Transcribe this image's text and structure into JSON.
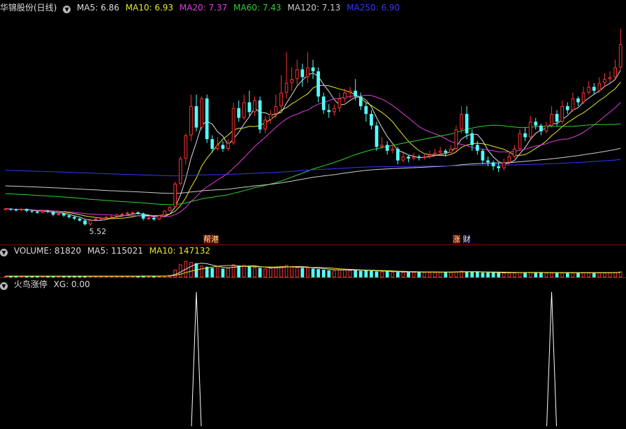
{
  "header": {
    "title": "华锦股份(日线)",
    "ma5": "MA5: 6.86",
    "ma10": "MA10: 6.93",
    "ma20": "MA20: 7.37",
    "ma60": "MA60: 7.43",
    "ma120": "MA120: 7.13",
    "ma250": "MA250: 6.90"
  },
  "volume_header": {
    "volume": "VOLUME: 81820",
    "ma5": "MA5: 115021",
    "ma10": "MA10: 147132"
  },
  "indicator_header": {
    "name": "火鸟涨停",
    "xg": "XG: 0.00"
  },
  "tags": [
    "帮港",
    "涨",
    "财"
  ],
  "price": {
    "low_label": "5.52"
  },
  "colors": {
    "up": "#ff3232",
    "down": "#54ffff",
    "ma5": "#dddddd",
    "ma10": "#e8e82a",
    "ma20": "#e23ce2",
    "ma60": "#30d030",
    "ma120": "#cccccc",
    "ma250": "#3535ff",
    "divider": "#a00000"
  },
  "chart_data": {
    "type": "candlestick",
    "price_range": [
      5.3,
      10.8
    ],
    "candles": [
      [
        5.92,
        5.96,
        5.86,
        5.85
      ],
      [
        5.95,
        5.93,
        5.97,
        5.9
      ],
      [
        5.93,
        5.92,
        5.96,
        5.88
      ],
      [
        5.92,
        5.95,
        5.98,
        5.9
      ],
      [
        5.95,
        5.9,
        5.96,
        5.86
      ],
      [
        5.9,
        5.88,
        5.93,
        5.84
      ],
      [
        5.88,
        5.85,
        5.9,
        5.82
      ],
      [
        5.85,
        5.9,
        5.93,
        5.83
      ],
      [
        5.9,
        5.88,
        5.92,
        5.84
      ],
      [
        5.88,
        5.8,
        5.9,
        5.76
      ],
      [
        5.8,
        5.83,
        5.86,
        5.77
      ],
      [
        5.83,
        5.78,
        5.85,
        5.74
      ],
      [
        5.78,
        5.74,
        5.8,
        5.7
      ],
      [
        5.74,
        5.7,
        5.76,
        5.66
      ],
      [
        5.7,
        5.65,
        5.72,
        5.62
      ],
      [
        5.65,
        5.55,
        5.68,
        5.52
      ],
      [
        5.55,
        5.66,
        5.7,
        5.52
      ],
      [
        5.66,
        5.7,
        5.73,
        5.62
      ],
      [
        5.7,
        5.72,
        5.75,
        5.66
      ],
      [
        5.72,
        5.74,
        5.77,
        5.68
      ],
      [
        5.74,
        5.75,
        5.78,
        5.7
      ],
      [
        5.75,
        5.8,
        5.83,
        5.72
      ],
      [
        5.8,
        5.82,
        5.85,
        5.76
      ],
      [
        5.82,
        5.85,
        5.88,
        5.78
      ],
      [
        5.85,
        5.86,
        5.9,
        5.8
      ],
      [
        5.86,
        5.83,
        5.88,
        5.8
      ],
      [
        5.83,
        5.7,
        5.86,
        5.65
      ],
      [
        5.7,
        5.72,
        5.75,
        5.66
      ],
      [
        5.72,
        5.68,
        5.74,
        5.64
      ],
      [
        5.68,
        5.78,
        5.8,
        5.66
      ],
      [
        5.78,
        5.9,
        5.92,
        5.76
      ],
      [
        5.9,
        6.0,
        6.03,
        5.88
      ],
      [
        6.0,
        6.6,
        6.65,
        5.98
      ],
      [
        6.6,
        7.25,
        7.3,
        6.55
      ],
      [
        7.25,
        7.85,
        7.9,
        7.1
      ],
      [
        7.85,
        8.6,
        8.9,
        7.7
      ],
      [
        8.6,
        8.05,
        8.9,
        7.95
      ],
      [
        8.05,
        8.8,
        8.85,
        7.98
      ],
      [
        8.8,
        7.75,
        8.9,
        7.65
      ],
      [
        7.75,
        7.5,
        7.85,
        7.4
      ],
      [
        7.5,
        7.6,
        7.8,
        7.45
      ],
      [
        7.6,
        7.5,
        7.7,
        7.42
      ],
      [
        7.5,
        7.65,
        7.75,
        7.45
      ],
      [
        7.65,
        8.55,
        8.7,
        7.6
      ],
      [
        8.55,
        8.3,
        8.75,
        8.2
      ],
      [
        8.3,
        8.7,
        8.9,
        8.25
      ],
      [
        8.7,
        8.45,
        9.0,
        8.35
      ],
      [
        8.45,
        8.75,
        8.85,
        8.35
      ],
      [
        8.75,
        8.0,
        8.85,
        7.9
      ],
      [
        8.0,
        8.25,
        8.35,
        7.9
      ],
      [
        8.25,
        8.4,
        8.5,
        8.15
      ],
      [
        8.4,
        8.6,
        8.9,
        8.3
      ],
      [
        8.6,
        8.95,
        9.4,
        8.5
      ],
      [
        8.95,
        9.2,
        10.0,
        8.8
      ],
      [
        9.2,
        9.3,
        9.6,
        9.0
      ],
      [
        9.3,
        9.55,
        9.8,
        9.15
      ],
      [
        9.55,
        9.35,
        9.7,
        9.1
      ],
      [
        9.35,
        9.6,
        10.0,
        9.2
      ],
      [
        9.6,
        9.5,
        9.8,
        9.3
      ],
      [
        9.5,
        8.85,
        9.6,
        8.7
      ],
      [
        8.85,
        8.5,
        8.95,
        8.4
      ],
      [
        8.5,
        8.45,
        8.65,
        8.3
      ],
      [
        8.45,
        8.55,
        8.65,
        8.35
      ],
      [
        8.55,
        8.8,
        8.95,
        8.45
      ],
      [
        8.8,
        8.95,
        9.05,
        8.7
      ],
      [
        8.95,
        9.0,
        9.1,
        8.8
      ],
      [
        9.0,
        8.85,
        9.3,
        8.75
      ],
      [
        8.85,
        8.6,
        8.95,
        8.5
      ],
      [
        8.6,
        8.4,
        8.7,
        8.2
      ],
      [
        8.4,
        8.1,
        8.5,
        8.0
      ],
      [
        8.1,
        7.55,
        8.2,
        7.45
      ],
      [
        7.55,
        7.6,
        7.8,
        7.5
      ],
      [
        7.6,
        7.45,
        7.7,
        7.35
      ],
      [
        7.45,
        7.5,
        7.6,
        7.38
      ],
      [
        7.5,
        7.2,
        7.55,
        7.1
      ],
      [
        7.2,
        7.3,
        7.4,
        7.15
      ],
      [
        7.3,
        7.25,
        7.35,
        7.15
      ],
      [
        7.25,
        7.3,
        7.4,
        7.2
      ],
      [
        7.3,
        7.28,
        7.35,
        7.2
      ],
      [
        7.28,
        7.3,
        7.38,
        7.22
      ],
      [
        7.3,
        7.35,
        7.45,
        7.25
      ],
      [
        7.35,
        7.4,
        7.5,
        7.3
      ],
      [
        7.4,
        7.45,
        7.55,
        7.35
      ],
      [
        7.45,
        7.4,
        7.5,
        7.3
      ],
      [
        7.4,
        7.5,
        7.6,
        7.35
      ],
      [
        7.5,
        8.0,
        8.1,
        7.45
      ],
      [
        8.0,
        8.4,
        8.6,
        7.9
      ],
      [
        8.4,
        7.9,
        8.6,
        7.75
      ],
      [
        7.9,
        7.6,
        8.0,
        7.45
      ],
      [
        7.6,
        7.45,
        7.7,
        7.35
      ],
      [
        7.45,
        7.2,
        7.5,
        7.1
      ],
      [
        7.2,
        7.15,
        7.3,
        7.05
      ],
      [
        7.15,
        7.05,
        7.2,
        6.95
      ],
      [
        7.05,
        7.0,
        7.15,
        6.9
      ],
      [
        7.0,
        7.15,
        7.25,
        6.95
      ],
      [
        7.15,
        7.3,
        7.4,
        7.1
      ],
      [
        7.3,
        7.5,
        7.6,
        7.25
      ],
      [
        7.5,
        7.9,
        8.0,
        7.45
      ],
      [
        7.9,
        7.8,
        8.05,
        7.7
      ],
      [
        7.8,
        8.2,
        8.35,
        7.75
      ],
      [
        8.2,
        8.1,
        8.3,
        8.0
      ],
      [
        8.1,
        7.95,
        8.15,
        7.85
      ],
      [
        7.95,
        8.1,
        8.2,
        7.9
      ],
      [
        8.1,
        8.4,
        8.6,
        8.05
      ],
      [
        8.4,
        8.2,
        8.5,
        8.1
      ],
      [
        8.2,
        8.6,
        8.75,
        8.15
      ],
      [
        8.6,
        8.5,
        8.7,
        8.4
      ],
      [
        8.5,
        8.8,
        8.95,
        8.45
      ],
      [
        8.8,
        8.7,
        8.85,
        8.6
      ],
      [
        8.7,
        8.95,
        9.1,
        8.65
      ],
      [
        8.95,
        9.1,
        9.25,
        8.9
      ],
      [
        9.1,
        9.0,
        9.2,
        8.9
      ],
      [
        9.0,
        9.2,
        9.35,
        8.95
      ],
      [
        9.2,
        9.3,
        9.45,
        9.1
      ],
      [
        9.3,
        9.35,
        9.5,
        9.2
      ],
      [
        9.35,
        9.6,
        9.8,
        9.3
      ],
      [
        9.6,
        10.2,
        10.6,
        9.55
      ]
    ],
    "volumes": [
      2,
      2,
      2,
      2,
      2,
      2,
      2,
      2,
      2,
      2,
      2,
      2,
      2,
      2,
      2,
      2,
      2,
      2,
      2,
      2,
      2,
      2,
      2,
      2,
      2,
      2,
      3,
      2,
      2,
      2,
      3,
      4,
      13,
      22,
      28,
      26,
      24,
      20,
      18,
      16,
      17,
      15,
      16,
      22,
      20,
      21,
      18,
      17,
      16,
      15,
      16,
      17,
      19,
      21,
      18,
      17,
      16,
      16,
      15,
      14,
      13,
      12,
      12,
      13,
      13,
      12,
      12,
      11,
      12,
      11,
      10,
      10,
      10,
      9,
      9,
      9,
      9,
      9,
      9,
      9,
      9,
      9,
      9,
      9,
      9,
      10,
      11,
      10,
      9,
      9,
      8,
      8,
      8,
      8,
      8,
      8,
      8,
      9,
      8,
      9,
      8,
      8,
      8,
      8,
      8,
      8,
      8,
      8,
      8,
      8,
      8,
      8,
      8,
      8,
      8,
      9,
      10
    ],
    "volume_range": [
      0,
      32
    ],
    "ma_lines": [
      "MA5",
      "MA10",
      "MA20",
      "MA60",
      "MA120",
      "MA250"
    ],
    "xg_signals": [
      36,
      103
    ]
  }
}
